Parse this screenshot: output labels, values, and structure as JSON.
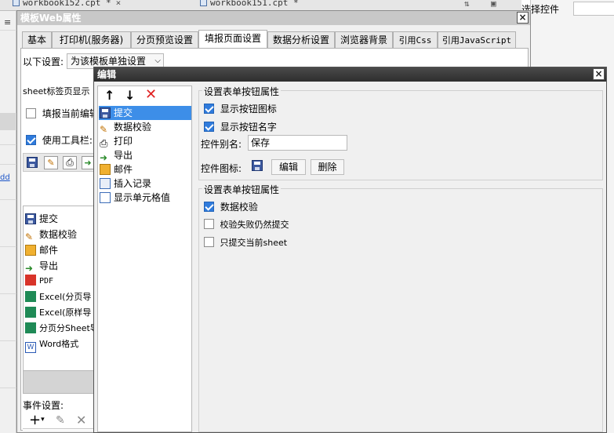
{
  "file_tabs": [
    {
      "label": "workbook152.cpt *"
    },
    {
      "label": "workbook151.cpt *"
    }
  ],
  "right_panel": {
    "label": "选择控件"
  },
  "outer_dialog": {
    "title": "模板Web属性",
    "tabs": [
      {
        "label": "基本"
      },
      {
        "label": "打印机(服务器)"
      },
      {
        "label": "分页预览设置"
      },
      {
        "label": "填报页面设置"
      },
      {
        "label": "数据分析设置"
      },
      {
        "label": "浏览器背景"
      },
      {
        "label": "引用Css"
      },
      {
        "label": "引用JavaScript"
      }
    ],
    "following_settings_label": "以下设置:",
    "following_settings_value": "为该模板单独设置",
    "sheet_label": "sheet标签页显示",
    "fill_current_label": "填报当前编辑",
    "use_toolbar_label": "使用工具栏:",
    "button_list": [
      {
        "label": "提交",
        "icon": "save-icon"
      },
      {
        "label": "数据校验",
        "icon": "pencil-icon"
      },
      {
        "label": "邮件",
        "icon": "mail-icon"
      },
      {
        "label": "导出",
        "icon": "export-icon"
      },
      {
        "label": "PDF",
        "icon": "pdf-icon"
      },
      {
        "label": "Excel(分页导",
        "icon": "excel-icon"
      },
      {
        "label": "Excel(原样导",
        "icon": "excel-icon"
      },
      {
        "label": "分页分Sheet导",
        "icon": "excel-icon"
      },
      {
        "label": "Word格式",
        "icon": "word-icon"
      }
    ],
    "event_settings_label": "事件设置:"
  },
  "edit_dialog": {
    "title": "编辑",
    "items": [
      {
        "label": "提交",
        "icon": "save-icon"
      },
      {
        "label": "数据校验",
        "icon": "pencil-icon"
      },
      {
        "label": "打印",
        "icon": "print-icon"
      },
      {
        "label": "导出",
        "icon": "export-icon"
      },
      {
        "label": "邮件",
        "icon": "mail-icon"
      },
      {
        "label": "插入记录",
        "icon": "insert-record-icon"
      },
      {
        "label": "显示单元格值",
        "icon": "cell-value-icon"
      }
    ],
    "group1": {
      "title": "设置表单按钮属性",
      "show_icon_label": "显示按钮图标",
      "show_name_label": "显示按钮名字",
      "alias_label": "控件别名:",
      "alias_value": "保存",
      "icon_label": "控件图标:",
      "edit_label": "编辑",
      "delete_label": "删除"
    },
    "group2": {
      "title": "设置表单按钮属性",
      "validate_label": "数据校验",
      "submit_on_fail_label": "校验失败仍然提交",
      "submit_current_label": "只提交当前sheet"
    }
  },
  "left_link": "dd"
}
